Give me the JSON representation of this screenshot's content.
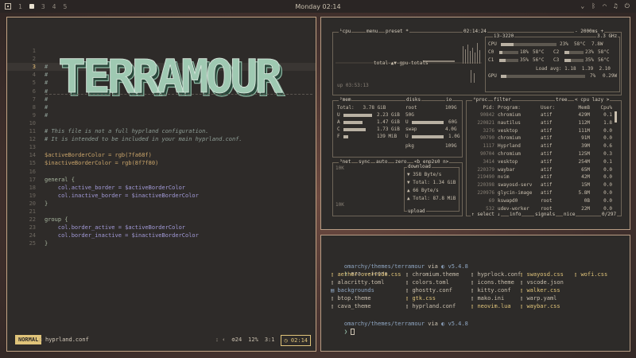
{
  "topbar": {
    "workspaces": [
      "1",
      "2",
      "3",
      "4",
      "5"
    ],
    "active_workspace": "2",
    "clock": "Monday 02:14",
    "tray_icons": [
      "chevron-down-icon",
      "bluetooth-icon",
      "wifi-icon",
      "headphones-icon",
      "power-icon"
    ]
  },
  "editor": {
    "banner_text": "TERRAMOUR",
    "lines": [
      {
        "n": "1",
        "text": ""
      },
      {
        "n": "2",
        "text": ""
      },
      {
        "n": "3",
        "text": "#"
      },
      {
        "n": "4",
        "text": "#"
      },
      {
        "n": "5",
        "text": "#"
      },
      {
        "n": "6",
        "text": "#"
      },
      {
        "n": "7",
        "text": "#"
      },
      {
        "n": "8",
        "text": "#"
      },
      {
        "n": "9",
        "text": "#"
      },
      {
        "n": "10",
        "text": ""
      },
      {
        "n": "11",
        "text": "# This file is not a full hyprland configuration."
      },
      {
        "n": "12",
        "text": "# It is intended to be included in your main hyprland.conf."
      },
      {
        "n": "13",
        "text": ""
      },
      {
        "n": "14",
        "text": "$activeBorderColor = rgb(7fa68f)"
      },
      {
        "n": "15",
        "text": "$inactiveBorderColor = rgb(8f7f80)"
      },
      {
        "n": "16",
        "text": ""
      },
      {
        "n": "17",
        "text": "general {"
      },
      {
        "n": "18",
        "text": "    col.active_border = $activeBorderColor"
      },
      {
        "n": "19",
        "text": "    col.inactive_border = $inactiveBorderColor"
      },
      {
        "n": "20",
        "text": "}"
      },
      {
        "n": "21",
        "text": ""
      },
      {
        "n": "22",
        "text": "group {"
      },
      {
        "n": "23",
        "text": "    col.border_active = $activeBorderColor"
      },
      {
        "n": "24",
        "text": "    col.border_inactive = $inactiveBorderColor"
      },
      {
        "n": "25",
        "text": "}"
      }
    ],
    "current_line": "3",
    "statusline": {
      "mode": "NORMAL",
      "filename": "hyprland.conf",
      "info": "24",
      "percent": "12%",
      "position": "3:1",
      "time": "02:14"
    }
  },
  "btop": {
    "cpu": {
      "title": "¹cpu",
      "menu": "menu",
      "preset": "preset *",
      "time": "02:14:24",
      "refresh": "- 2000ms +",
      "model": "i3-3220",
      "freq": "3.3 GHz",
      "uptime": "up 03:53:13",
      "graph_label": "total-▲▼-gpu-totals",
      "rows": [
        {
          "label": "CPU",
          "pct": "23%",
          "temp": "58°C",
          "watt": "7.8W"
        },
        {
          "label": "C0",
          "pct": "18%",
          "temp": "58°C"
        },
        {
          "label": "C1",
          "pct": "35%",
          "temp": "56°C"
        },
        {
          "label": "C2",
          "pct": "23%",
          "temp": "58°C"
        },
        {
          "label": "C3",
          "pct": "35%",
          "temp": "56°C"
        }
      ],
      "load_avg": "Load avg: 1.18  1.39  2.10",
      "gpu_pct": "7%",
      "gpu_watt": "0.29W",
      "gpu_label": "GPU"
    },
    "mem": {
      "title": "²mem",
      "total": "Total:   3.78 GiB",
      "rows": [
        {
          "k": "U",
          "v": "2.23 GiB"
        },
        {
          "k": "A",
          "v": "1.47 GiB"
        },
        {
          "k": "C",
          "v": "1.73 GiB"
        },
        {
          "k": "F",
          "v": "139 MiB"
        }
      ]
    },
    "disks": {
      "title": "disks",
      "io": "io",
      "root": "root",
      "root_size": "109G",
      "root_used": "50G",
      "u_label": "U",
      "u_val": "60G",
      "swap": "swap",
      "swap_size": "4.0G",
      "u2_val": "1.0G",
      "pkg": "pkg",
      "pkg_size": "109G"
    },
    "net": {
      "title": "³net",
      "sync": "sync",
      "auto": "auto",
      "zero": "zero",
      "iface": "<b enp2s0 n>",
      "scale_top": "10K",
      "scale_bottom": "10K",
      "download": "download",
      "rows": [
        "▼ 358 Byte/s",
        "▼ Total: 1.34 GiB",
        "▲ 66 Byte/s",
        "▲ Total: 87.8 MiB"
      ],
      "upload": "upload"
    },
    "proc": {
      "title": "⁴proc",
      "filter": "filter",
      "tree": "tree",
      "sort": "< cpu lazy >",
      "headers": [
        "Pid:",
        "Program:",
        "User:",
        "MemB",
        "Cpu%"
      ],
      "rows": [
        [
          "90842",
          "chromium",
          "atif",
          "429M",
          "0.1"
        ],
        [
          "220821",
          "nautilus",
          "atif",
          "112M",
          "1.8"
        ],
        [
          "3276",
          "vesktop",
          "atif",
          "111M",
          "0.0"
        ],
        [
          "90790",
          "chromium",
          "atif",
          "91M",
          "0.0"
        ],
        [
          "1117",
          "Hyprland",
          "atif",
          "39M",
          "0.6"
        ],
        [
          "90704",
          "chromium",
          "atif",
          "125M",
          "0.3"
        ],
        [
          "3414",
          "vesktop",
          "atif",
          "254M",
          "0.1"
        ],
        [
          "220379",
          "waybar",
          "atif",
          "65M",
          "0.0"
        ],
        [
          "219490",
          "nvim",
          "atif",
          "42M",
          "0.0"
        ],
        [
          "220398",
          "swayosd-serv",
          "atif",
          "15M",
          "0.0"
        ],
        [
          "220976",
          "glycin-image",
          "atif",
          "5.8M",
          "0.0"
        ],
        [
          "69",
          "kswapd0",
          "root",
          "0B",
          "0.0"
        ],
        [
          "532",
          "udev-worker",
          "root",
          "22M",
          "0.0"
        ]
      ],
      "footer_left": "↑ select ↓",
      "footer_info": "info",
      "footer_signals": "signals",
      "footer_nice": "nice",
      "footer_count": "0/297"
    }
  },
  "terminal": {
    "prompt1": {
      "path": "omarchy/themes/terramour",
      "via": " via ",
      "lang": "v5.4.8"
    },
    "command": "eza --icons",
    "files": [
      [
        "aether.override.css",
        "chromium.theme",
        "hyprlock.conf",
        "swayosd.css",
        "wofi.css"
      ],
      [
        "alacritty.toml",
        "colors.toml",
        "icons.theme",
        "vscode.json",
        ""
      ],
      [
        "backgrounds",
        "ghostty.conf",
        "kitty.conf",
        "walker.css",
        ""
      ],
      [
        "btop.theme",
        "gtk.css",
        "mako.ini",
        "warp.yaml",
        ""
      ],
      [
        "cava_theme",
        "hyprland.conf",
        "neovim.lua",
        "waybar.css",
        ""
      ]
    ],
    "prompt2": {
      "path": "omarchy/themes/terramour",
      "via": " via ",
      "lang": "v5.4.8"
    },
    "prompt_char": "❯"
  }
}
